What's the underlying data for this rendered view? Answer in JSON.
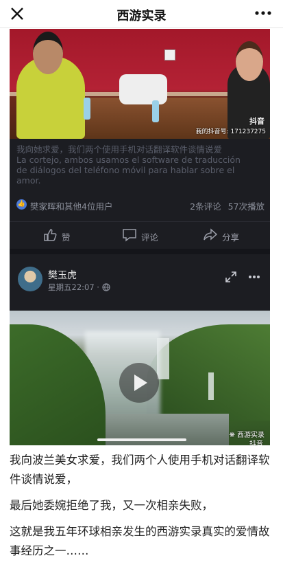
{
  "topbar": {
    "title": "西游实录",
    "close_icon": "close-icon",
    "more_icon": "more-dots-icon"
  },
  "post": {
    "watermark_logo": "抖音",
    "watermark_id": "我的抖音号: 171237275",
    "caption_lines": [
      "我向她求爱，我们两个使用手机对话翻译软件谈情说爱",
      "La cortejo, ambos usamos el software de traducción",
      "de diálogos del teléfono móvil para hablar sobre el",
      "amor."
    ],
    "likers": "樊家晖和其他4位用户",
    "comments": "2条评论",
    "plays": "57次播放",
    "actions": {
      "like": "赞",
      "comment": "评论",
      "share": "分享"
    }
  },
  "author": {
    "name": "樊玉虎",
    "time": "星期五22:07 ·"
  },
  "video": {
    "brand_tag": "西游实录",
    "douyin_tag": "抖音",
    "progress": 0.0
  },
  "article": {
    "paragraphs": [
      "我向波兰美女求爱，我们两个人使用手机对话翻译软件谈情说爱，",
      "最后她委婉拒绝了我，又一次相亲失败，",
      "这就是我五年环球相亲发生的西游实录真实的爱情故事经历之一……"
    ]
  },
  "colors": {
    "card_bg": "#1c1d22",
    "accent_blue": "#4a79d9",
    "muted_text": "#8a8e99"
  }
}
